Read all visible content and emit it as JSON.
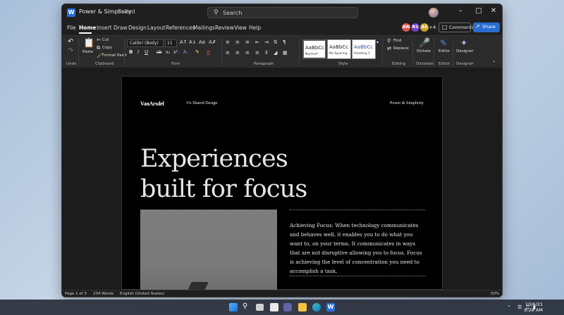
{
  "window": {
    "app_icon": "W",
    "doc_title": "Power & Simplicity",
    "save_status": "Saved",
    "search_placeholder": "Search"
  },
  "menu": {
    "tabs": [
      "File",
      "Home",
      "Insert",
      "Draw",
      "Design",
      "Layout",
      "References",
      "Mailings",
      "Review",
      "View",
      "Help"
    ],
    "active_tab": "Home",
    "collaborators": [
      {
        "initials": "AW",
        "color": "#d9534f"
      },
      {
        "initials": "RS",
        "color": "#6f42c1"
      },
      {
        "initials": "AS",
        "color": "#c9a227"
      }
    ],
    "more_collaborators": "+4",
    "comments_label": "Comments",
    "share_label": "Share"
  },
  "ribbon": {
    "groups": [
      "Undo",
      "Clipboard",
      "Font",
      "Paragraph",
      "Style",
      "Editing",
      "Dictation",
      "Editor",
      "Designer"
    ],
    "paste_label": "Paste",
    "cut_label": "Cut",
    "copy_label": "Copy",
    "format_paint_label": "Format Paint",
    "font_name": "Calibri (Body)",
    "font_size": "11",
    "styles": [
      {
        "sample": "AaBbCc",
        "name": "Normal*"
      },
      {
        "sample": "AaBbCc",
        "name": "No Spacing"
      },
      {
        "sample": "AaBbCc",
        "name": "Heading 1"
      }
    ],
    "find_label": "Find",
    "replace_label": "Replace",
    "dictate_label": "Dictate",
    "editor_label": "Editor",
    "designer_label": "Designer"
  },
  "document": {
    "logo": "VanArsdel",
    "header_center": "VA Shared Design",
    "header_right": "Power & Simplicity",
    "headline_line1": "Experiences",
    "headline_line2": "built for focus",
    "body": "Achieving Focus: When technology communicates and behaves well, it enables you to do what you want to, on your terms. It communicates in ways that are not disruptive allowing you to focus. Focus is achieving the level of concentration you need to accomplish a task."
  },
  "status": {
    "page": "Page 1 of 3",
    "words": "234 Words",
    "language": "English (United States)",
    "zoom": "50%"
  },
  "taskbar": {
    "date": "10/6/21",
    "time": "9:28 AM"
  }
}
